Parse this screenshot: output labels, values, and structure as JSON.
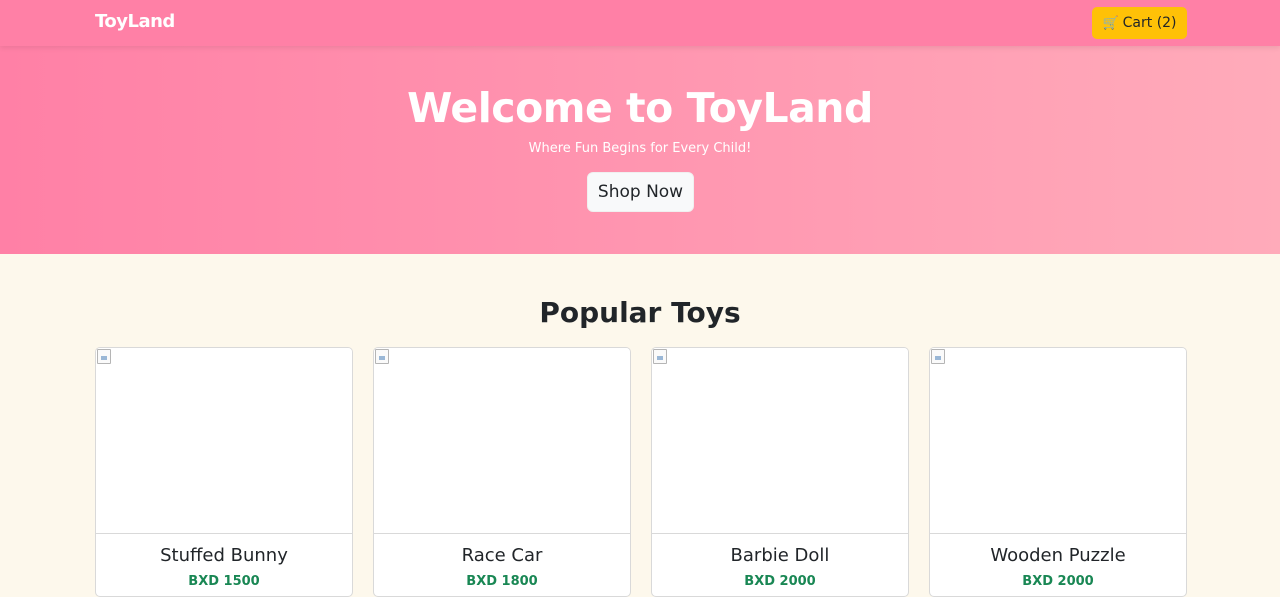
{
  "navbar": {
    "brand": "ToyLand",
    "cart_icon": "🛒",
    "cart_label": "Cart (2)"
  },
  "hero": {
    "title": "Welcome to ToyLand",
    "subtitle": "Where Fun Begins for Every Child!",
    "cta": "Shop Now"
  },
  "products_section": {
    "title": "Popular Toys",
    "items": [
      {
        "name": "Stuffed Bunny",
        "price": "BXD 1500"
      },
      {
        "name": "Race Car",
        "price": "BXD 1800"
      },
      {
        "name": "Barbie Doll",
        "price": "BXD 2000"
      },
      {
        "name": "Wooden Puzzle",
        "price": "BXD 2000"
      }
    ]
  },
  "colors": {
    "navbar": "#ff80a6",
    "hero_start": "#ff80a6",
    "hero_end": "#ffabba",
    "cart_button": "#ffc107",
    "page_background": "#fdf8ec",
    "price": "#198754"
  }
}
